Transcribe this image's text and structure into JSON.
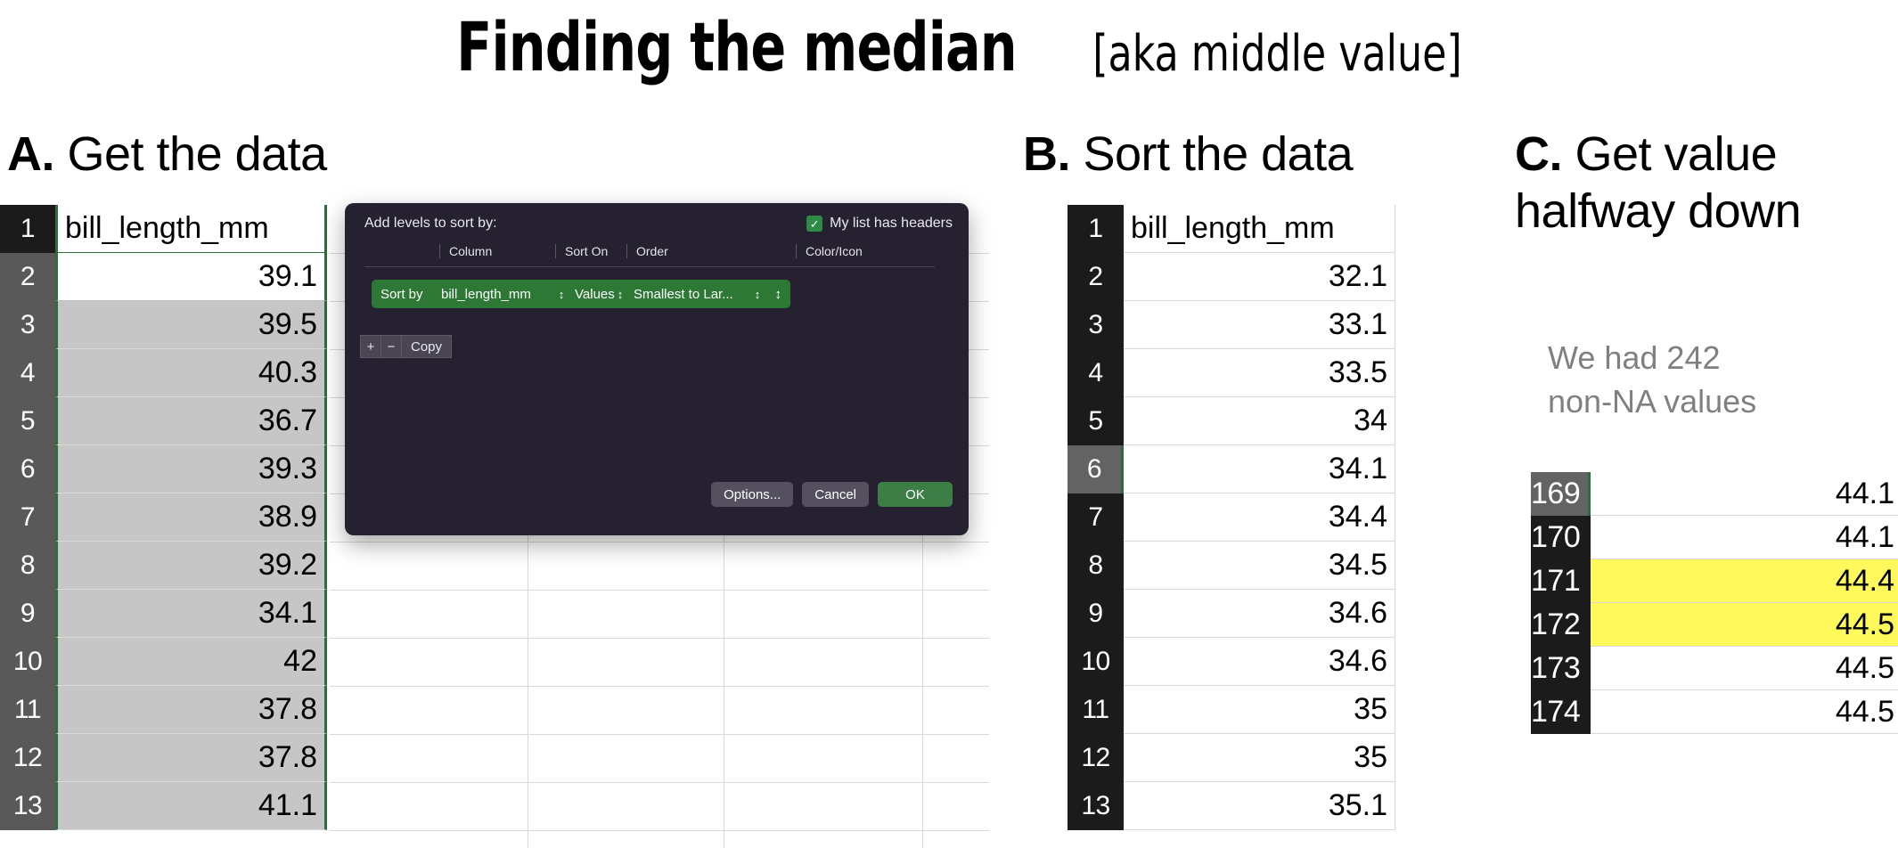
{
  "title": {
    "main": "Finding the median",
    "sub": "[aka middle value]"
  },
  "sections": {
    "a": {
      "letter": "A.",
      "text": " Get the data"
    },
    "b": {
      "letter": "B.",
      "text": " Sort the data"
    },
    "c": {
      "letter": "C.",
      "text": " Get value halfway down"
    }
  },
  "panel_a": {
    "column_header": "bill_length_mm",
    "rows": [
      {
        "n": "1",
        "value": "bill_length_mm",
        "header": true
      },
      {
        "n": "2",
        "value": "39.1"
      },
      {
        "n": "3",
        "value": "39.5"
      },
      {
        "n": "4",
        "value": "40.3"
      },
      {
        "n": "5",
        "value": "36.7"
      },
      {
        "n": "6",
        "value": "39.3"
      },
      {
        "n": "7",
        "value": "38.9"
      },
      {
        "n": "8",
        "value": "39.2"
      },
      {
        "n": "9",
        "value": "34.1"
      },
      {
        "n": "10",
        "value": "42"
      },
      {
        "n": "11",
        "value": "37.8"
      },
      {
        "n": "12",
        "value": "37.8"
      },
      {
        "n": "13",
        "value": "41.1"
      }
    ]
  },
  "panel_b": {
    "column_header": "bill_length_mm",
    "rows": [
      {
        "n": "1",
        "value": "bill_length_mm",
        "header": true
      },
      {
        "n": "2",
        "value": "32.1"
      },
      {
        "n": "3",
        "value": "33.1"
      },
      {
        "n": "4",
        "value": "33.5"
      },
      {
        "n": "5",
        "value": "34"
      },
      {
        "n": "6",
        "value": "34.1",
        "active": true
      },
      {
        "n": "7",
        "value": "34.4"
      },
      {
        "n": "8",
        "value": "34.5"
      },
      {
        "n": "9",
        "value": "34.6"
      },
      {
        "n": "10",
        "value": "34.6"
      },
      {
        "n": "11",
        "value": "35"
      },
      {
        "n": "12",
        "value": "35"
      },
      {
        "n": "13",
        "value": "35.1"
      }
    ]
  },
  "panel_c": {
    "note": "We had 242\nnon-NA values",
    "highlight_color": "#fff95c",
    "rows": [
      {
        "n": "169",
        "value": "44.1",
        "active": true
      },
      {
        "n": "170",
        "value": "44.1"
      },
      {
        "n": "171",
        "value": "44.4",
        "highlight": true
      },
      {
        "n": "172",
        "value": "44.5",
        "highlight": true
      },
      {
        "n": "173",
        "value": "44.5"
      },
      {
        "n": "174",
        "value": "44.5"
      }
    ]
  },
  "sort_dialog": {
    "prompt": "Add levels to sort by:",
    "headers_checkbox_label": "My list has headers",
    "headers_checkbox_checked": true,
    "checkbox_glyph": "✓",
    "columns": [
      "Column",
      "Sort On",
      "Order",
      "Color/Icon"
    ],
    "level": {
      "label": "Sort by",
      "column": "bill_length_mm",
      "sort_on": "Values",
      "order": "Smallest to Lar...",
      "color_icon": "",
      "stepper_glyph": "⌃⌄"
    },
    "add_button": "+",
    "remove_button": "−",
    "copy_button": "Copy",
    "options_button": "Options...",
    "cancel_button": "Cancel",
    "ok_button": "OK",
    "accent_color": "#2e7836",
    "background_color": "#262130"
  }
}
